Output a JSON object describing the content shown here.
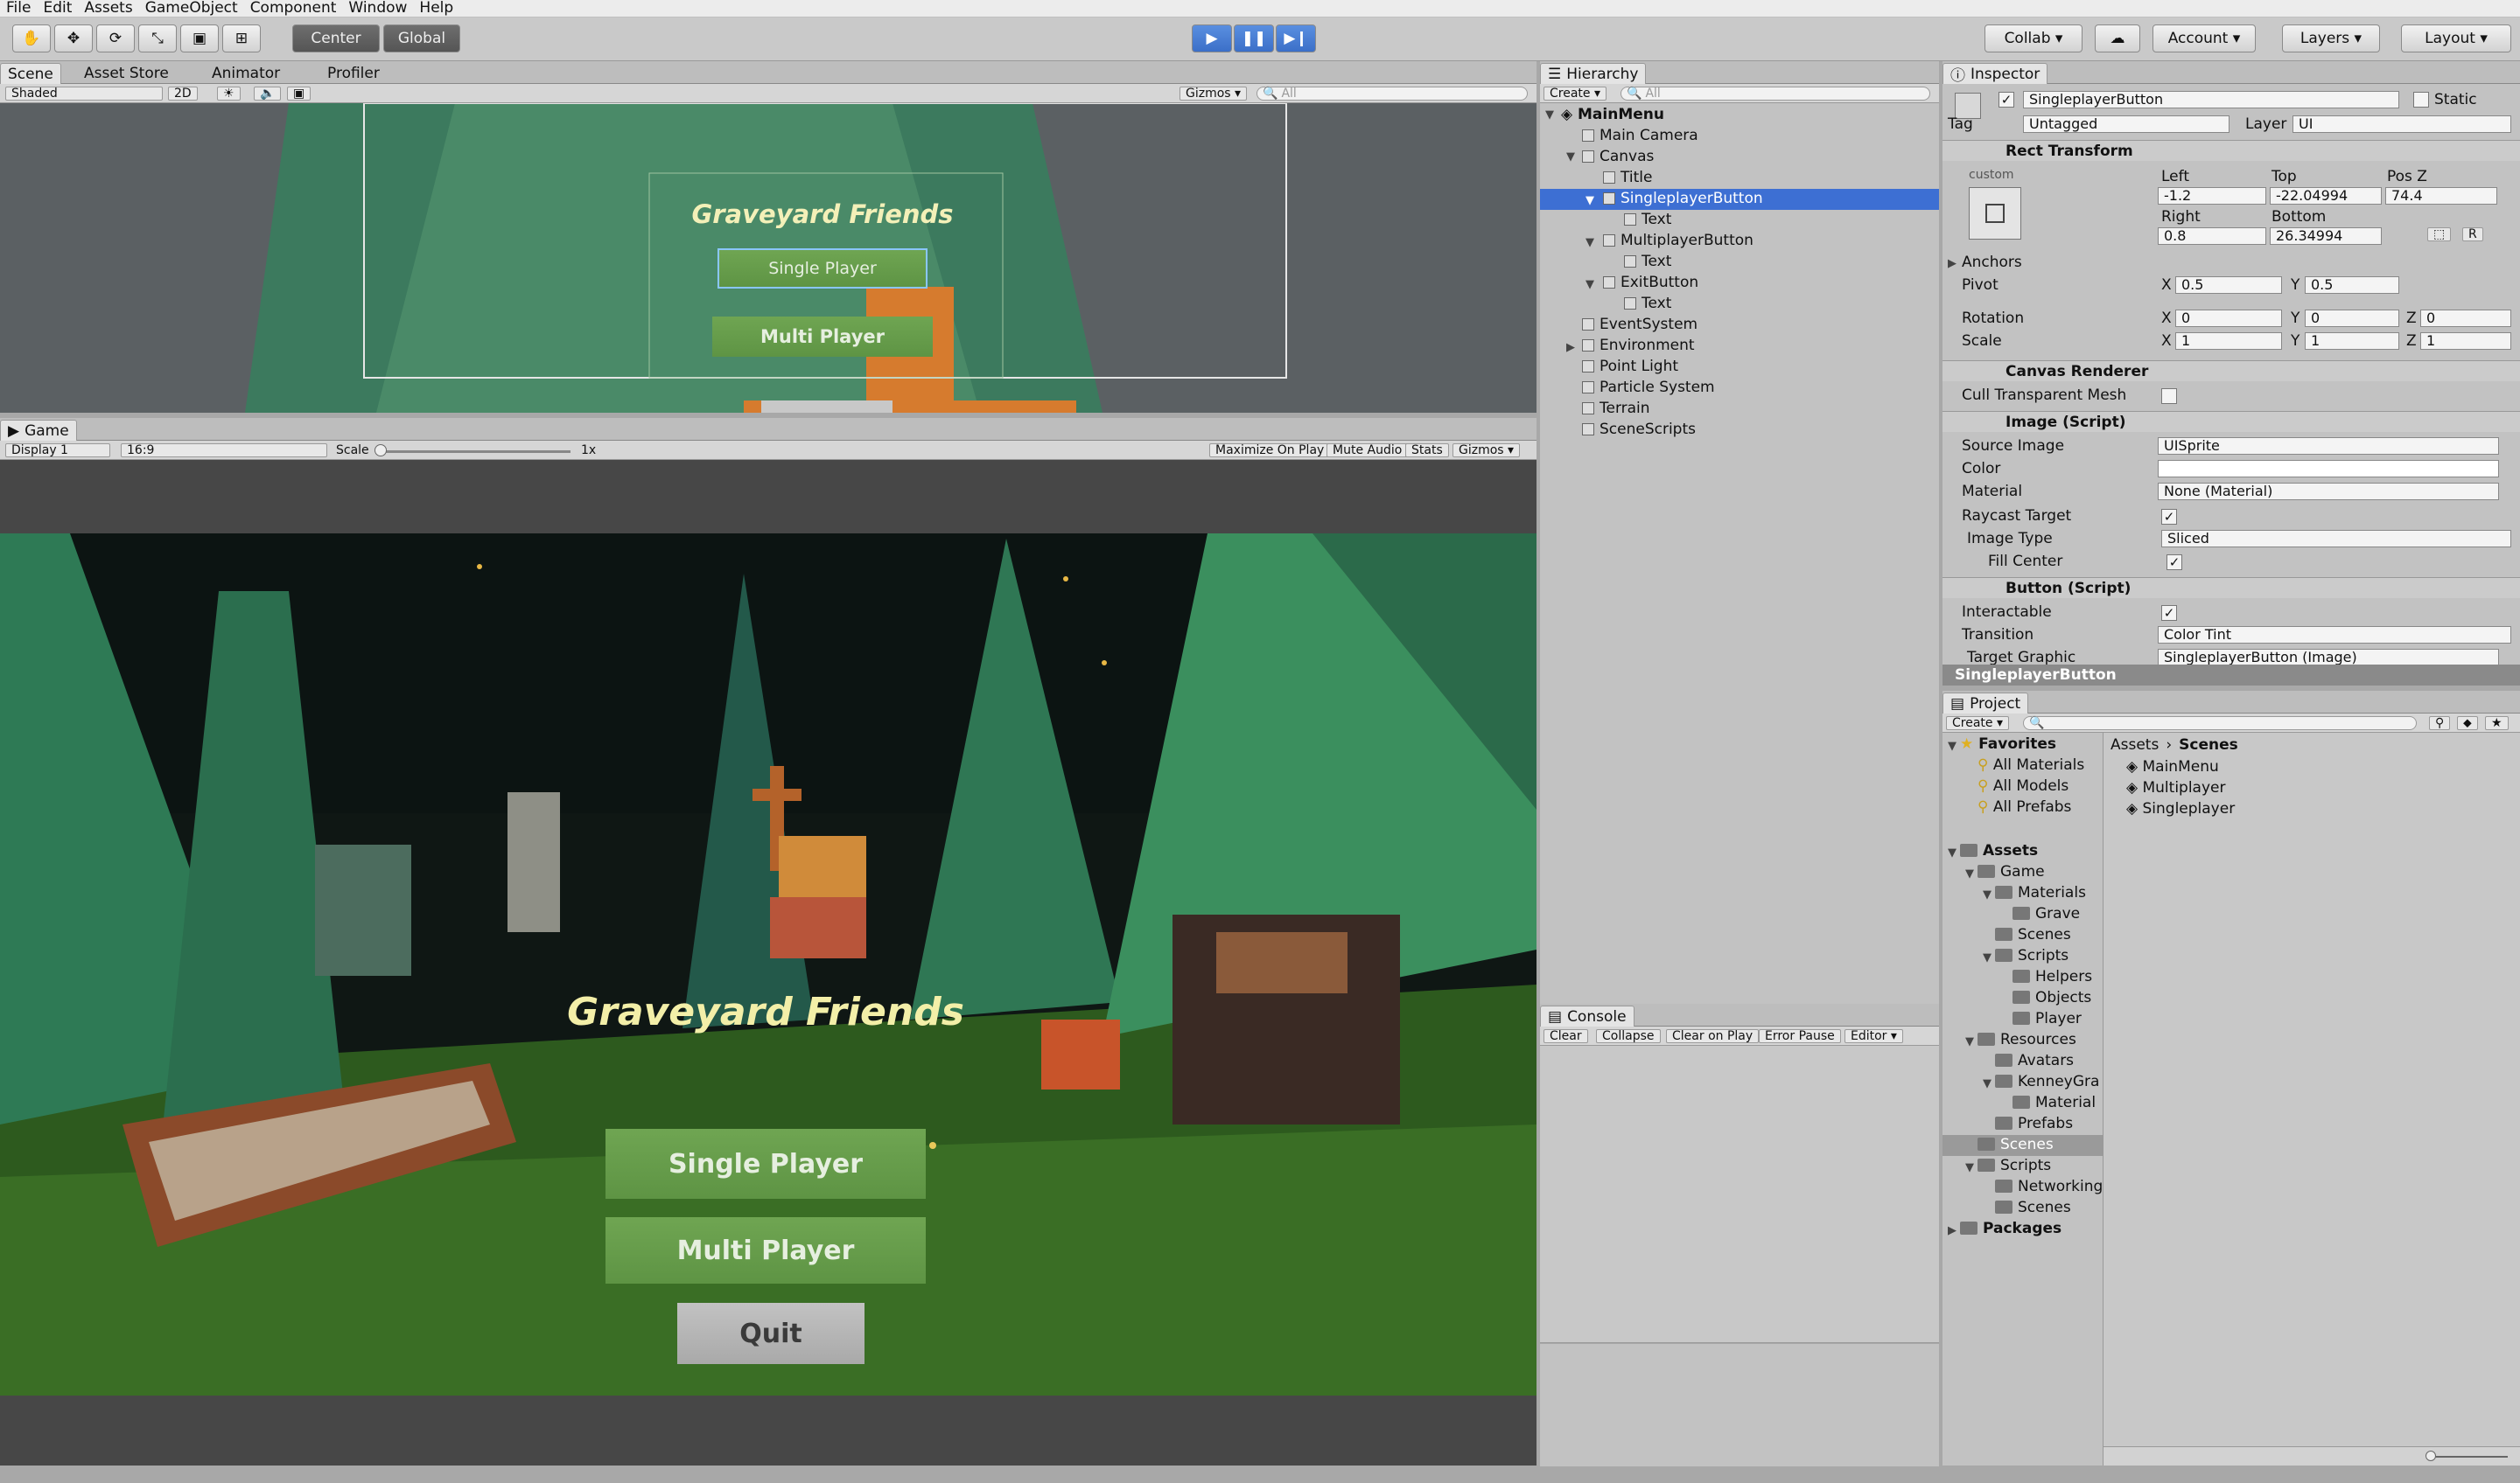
{
  "menu": [
    "File",
    "Edit",
    "Assets",
    "GameObject",
    "Component",
    "Window",
    "Help"
  ],
  "toolbar": {
    "pivot": "Center",
    "space": "Global",
    "collab": "Collab",
    "account": "Account",
    "layers": "Layers",
    "layout": "Layout"
  },
  "scene": {
    "tabs": [
      "Scene",
      "Asset Store",
      "Animator",
      "Profiler"
    ],
    "shading": "Shaded",
    "mode2d": "2D",
    "gizmos": "Gizmos",
    "search_placeholder": "All",
    "title": "Graveyard Friends",
    "btn1": "Single Player",
    "btn2": "Multi Player"
  },
  "game": {
    "tab": "Game",
    "display": "Display 1",
    "aspect": "16:9",
    "scale_label": "Scale",
    "scale_value": "1x",
    "toggles": [
      "Maximize On Play",
      "Mute Audio",
      "Stats",
      "Gizmos"
    ],
    "title": "Graveyard Friends",
    "btn1": "Single Player",
    "btn2": "Multi Player",
    "btn3": "Quit"
  },
  "hierarchy": {
    "tab": "Hierarchy",
    "create": "Create",
    "search_placeholder": "All",
    "root": "MainMenu",
    "items": [
      "Main Camera",
      "Canvas",
      "Title",
      "SingleplayerButton",
      "Text",
      "MultiplayerButton",
      "Text",
      "ExitButton",
      "Text",
      "EventSystem",
      "Environment",
      "Point Light",
      "Particle System",
      "Terrain",
      "SceneScripts"
    ]
  },
  "console": {
    "tab": "Console",
    "buttons": [
      "Clear",
      "Collapse",
      "Clear on Play",
      "Error Pause",
      "Editor"
    ]
  },
  "inspector": {
    "tab": "Inspector",
    "name": "SingleplayerButton",
    "static": "Static",
    "tag_label": "Tag",
    "tag": "Untagged",
    "layer_label": "Layer",
    "layer": "UI",
    "rect": {
      "title": "Rect Transform",
      "custom": "custom",
      "left_l": "Left",
      "top_l": "Top",
      "posz_l": "Pos Z",
      "left": "-1.2",
      "top": "-22.04994",
      "posz": "74.4",
      "right_l": "Right",
      "bottom_l": "Bottom",
      "right": "0.8",
      "bottom": "26.34994",
      "anchors": "Anchors",
      "pivot": "Pivot",
      "pivot_x": "0.5",
      "pivot_y": "0.5",
      "rotation": "Rotation",
      "rot_x": "0",
      "rot_y": "0",
      "rot_z": "0",
      "scale": "Scale",
      "scale_x": "1",
      "scale_y": "1",
      "scale_z": "1",
      "r_btn": "R"
    },
    "canvas_renderer": {
      "title": "Canvas Renderer",
      "cull": "Cull Transparent Mesh"
    },
    "image": {
      "title": "Image (Script)",
      "source_l": "Source Image",
      "source": "UISprite",
      "color_l": "Color",
      "material_l": "Material",
      "material": "None (Material)",
      "raycast_l": "Raycast Target",
      "type_l": "Image Type",
      "type": "Sliced",
      "fill_l": "Fill Center"
    },
    "button": {
      "title": "Button (Script)",
      "interactable_l": "Interactable",
      "transition_l": "Transition",
      "transition": "Color Tint",
      "target_l": "Target Graphic",
      "target": "SingleplayerButton (Image)"
    },
    "footer": "SingleplayerButton",
    "x": "X",
    "y": "Y",
    "z": "Z"
  },
  "project": {
    "tab": "Project",
    "create": "Create",
    "favorites": "Favorites",
    "fav_items": [
      "All Materials",
      "All Models",
      "All Prefabs"
    ],
    "assets": "Assets",
    "tree": [
      "Game",
      "Materials",
      "Grave",
      "Scenes",
      "Scripts",
      "Helpers",
      "Objects",
      "Player",
      "Resources",
      "Avatars",
      "KenneyGra",
      "Material",
      "Prefabs",
      "Scenes",
      "Scripts",
      "Networking",
      "Scenes"
    ],
    "packages": "Packages",
    "breadcrumb_root": "Assets",
    "breadcrumb_leaf": "Scenes",
    "files": [
      "MainMenu",
      "Multiplayer",
      "Singleplayer"
    ]
  },
  "colors": {
    "selected": "#3d6fd3",
    "panel": "#c2c2c2",
    "button_green": "#64a04b",
    "quit_gray": "#b9b9b9"
  }
}
